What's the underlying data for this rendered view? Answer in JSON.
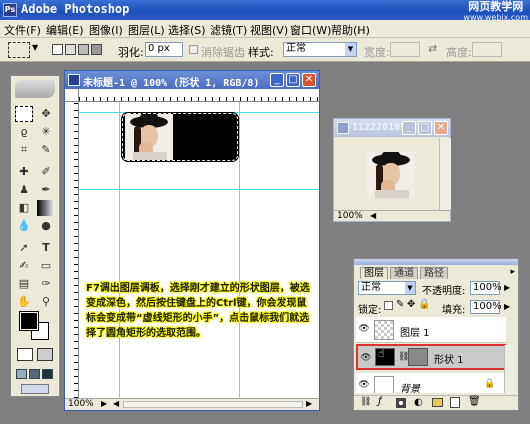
{
  "app": {
    "title": "Adobe Photoshop",
    "logo_text": "Ps",
    "watermark_title": "网页教学网",
    "watermark_url": "www.webjx.com",
    "controls": [
      "minimize",
      "maximize",
      "close"
    ]
  },
  "menu": [
    "文件(F)",
    "编辑(E)",
    "图像(I)",
    "图层(L)",
    "选择(S)",
    "滤镜(T)",
    "视图(V)",
    "窗口(W)",
    "帮助(H)"
  ],
  "options": {
    "feather_label": "羽化:",
    "feather_value": "0 px",
    "antialias_label": "消除锯齿",
    "style_label": "样式:",
    "style_value": "正常",
    "width_label": "宽度:",
    "height_label": "高度:"
  },
  "doc_main": {
    "title": "未标题-1 @ 100% (形状 1, RGB/8)",
    "zoom": "100%",
    "instruction": "F7调出图层调板，选择刚才建立的形状图层，被选变成深色，然后按住键盘上的Ctrl键，你会发现鼠标会变成带“虚线矩形的小手”，点击鼠标我们就选择了圆角矩形的选取范围。",
    "colors": {
      "canvas": "#ffffff",
      "shape_fill": "#000000",
      "guide": "#4fe0f0",
      "text_glow": "#ffff00"
    }
  },
  "doc_second": {
    "title": "1122201057...",
    "zoom": "100%"
  },
  "layers_panel": {
    "tabs": [
      "图层",
      "通道",
      "路径"
    ],
    "blend_mode": "正常",
    "opacity_label": "不透明度:",
    "opacity_value": "100%",
    "lock_label": "锁定:",
    "fill_label": "填充:",
    "fill_value": "100%",
    "layers": [
      {
        "name": "图层 1",
        "visible": true,
        "selected": false
      },
      {
        "name": "形状 1",
        "visible": true,
        "selected": true
      },
      {
        "name": "背景",
        "visible": true,
        "selected": false
      }
    ],
    "highlight_color": "#e03030"
  },
  "tools": [
    "rect-marquee",
    "move",
    "lasso",
    "magic-wand",
    "crop",
    "slice",
    "healing",
    "brush",
    "stamp",
    "history-brush",
    "eraser",
    "gradient",
    "blur",
    "dodge",
    "path-select",
    "type",
    "pen",
    "shape",
    "notes",
    "eyedropper",
    "hand",
    "zoom"
  ],
  "colors": {
    "foreground": "#000000",
    "background": "#ffffff",
    "workspace": "#7f7f7f",
    "chrome": "#ece9d8",
    "title_blue": "#1f4fb8"
  }
}
